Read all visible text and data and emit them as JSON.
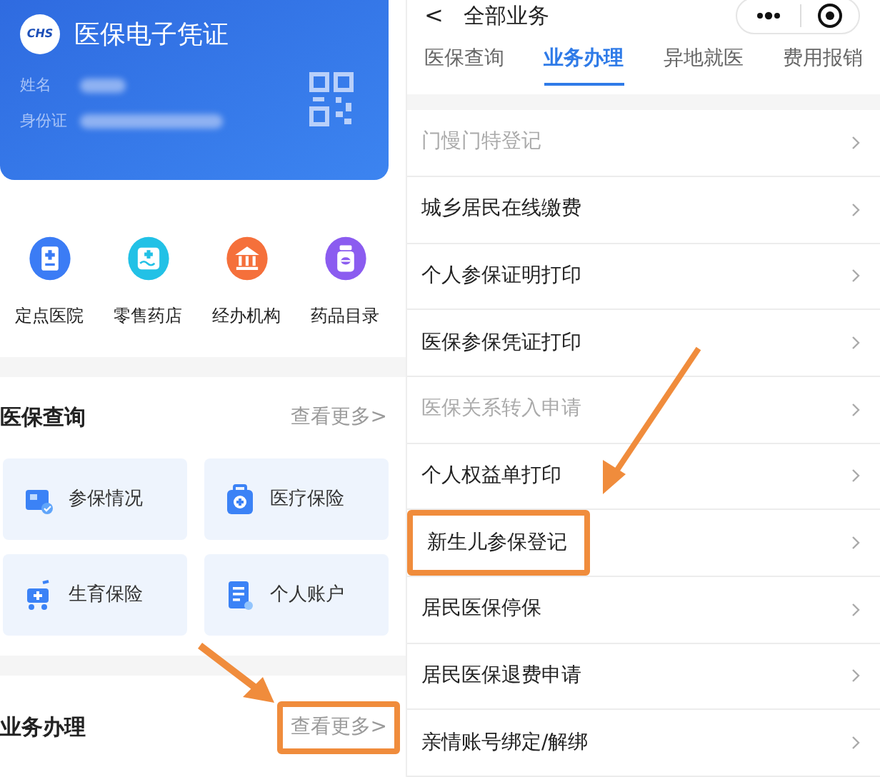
{
  "left": {
    "card": {
      "logo_text": "CHS",
      "title": "医保电子凭证",
      "fields": [
        {
          "label": "姓名"
        },
        {
          "label": "身份证"
        }
      ]
    },
    "shortcuts": [
      {
        "label": "定点医院",
        "kind": "hospital",
        "color": "#3b7cf5"
      },
      {
        "label": "零售药店",
        "kind": "pharmacy",
        "color": "#22c1e6"
      },
      {
        "label": "经办机构",
        "kind": "institution",
        "color": "#f5703b"
      },
      {
        "label": "药品目录",
        "kind": "medicine",
        "color": "#8b5cf0"
      }
    ],
    "query_section": {
      "title": "医保查询",
      "more": "查看更多>",
      "highlighted": false,
      "tiles": [
        {
          "label": "参保情况",
          "kind": "card"
        },
        {
          "label": "医疗保险",
          "kind": "kit"
        },
        {
          "label": "生育保险",
          "kind": "stroller"
        },
        {
          "label": "个人账户",
          "kind": "doc"
        }
      ]
    },
    "business_section": {
      "title": "业务办理",
      "more": "查看更多>",
      "highlighted": true
    }
  },
  "right": {
    "header": {
      "back": "<",
      "title": "全部业务"
    },
    "tabs": [
      {
        "label": "医保查询",
        "selected": false
      },
      {
        "label": "业务办理",
        "selected": true
      },
      {
        "label": "异地就医",
        "selected": false
      },
      {
        "label": "费用报销",
        "selected": false
      }
    ],
    "rows": [
      {
        "label": "门慢门特登记",
        "disabled": true,
        "highlighted": false
      },
      {
        "label": "城乡居民在线缴费",
        "disabled": false,
        "highlighted": false
      },
      {
        "label": "个人参保证明打印",
        "disabled": false,
        "highlighted": false
      },
      {
        "label": "医保参保凭证打印",
        "disabled": false,
        "highlighted": false
      },
      {
        "label": "医保关系转入申请",
        "disabled": true,
        "highlighted": false
      },
      {
        "label": "个人权益单打印",
        "disabled": false,
        "highlighted": false
      },
      {
        "label": "新生儿参保登记",
        "disabled": false,
        "highlighted": true
      },
      {
        "label": "居民医保停保",
        "disabled": false,
        "highlighted": false
      },
      {
        "label": "居民医保退费申请",
        "disabled": false,
        "highlighted": false
      },
      {
        "label": "亲情账号绑定/解绑",
        "disabled": false,
        "highlighted": false
      }
    ]
  }
}
